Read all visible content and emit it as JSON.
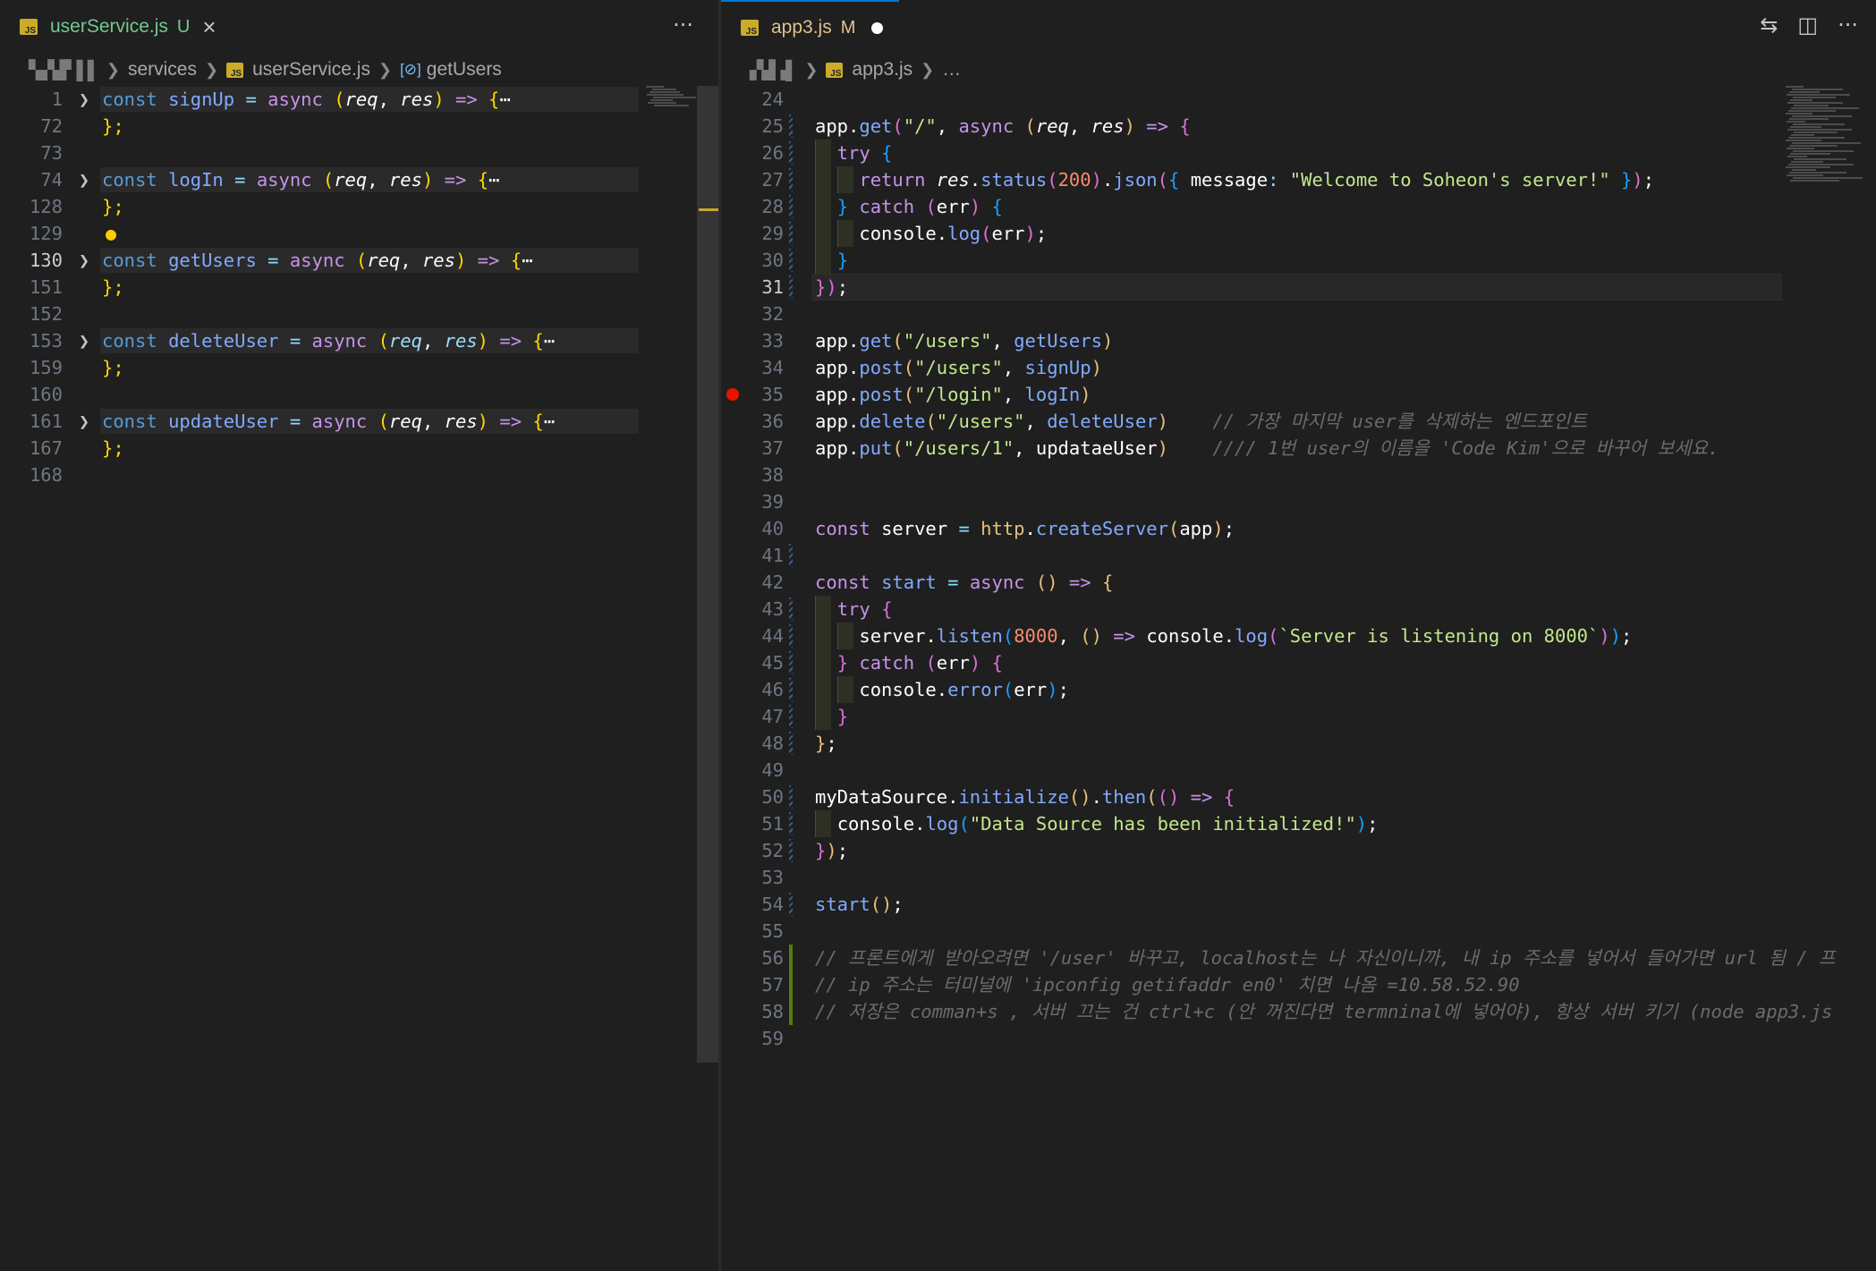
{
  "left": {
    "tab": {
      "filename": "userService.js",
      "badge": "U",
      "close": "×"
    },
    "more": "···",
    "breadcrumb": {
      "obscured": "▚▞▟▘▌▌",
      "folder": "services",
      "file": "userService.js",
      "symbol": "getUsers"
    },
    "lines": [
      {
        "num": "1",
        "folded": true,
        "tokens": [
          [
            "const ",
            "ks"
          ],
          [
            "signUp",
            "bl"
          ],
          [
            " = ",
            "cy"
          ],
          [
            "async ",
            "pu"
          ],
          [
            "(",
            "fy"
          ],
          [
            "req",
            "wi"
          ],
          [
            ", ",
            "w"
          ],
          [
            "res",
            "wi"
          ],
          [
            ")",
            "fy"
          ],
          [
            " => ",
            "pu"
          ],
          [
            "{",
            "fy"
          ],
          [
            "⋯",
            "w"
          ]
        ]
      },
      {
        "num": "72",
        "tokens": [
          [
            "};",
            "fy"
          ]
        ]
      },
      {
        "num": "73",
        "tokens": []
      },
      {
        "num": "74",
        "folded": true,
        "tokens": [
          [
            "const ",
            "ks"
          ],
          [
            "logIn",
            "bl"
          ],
          [
            " = ",
            "cy"
          ],
          [
            "async ",
            "pu"
          ],
          [
            "(",
            "fy"
          ],
          [
            "req",
            "wi"
          ],
          [
            ", ",
            "w"
          ],
          [
            "res",
            "wi"
          ],
          [
            ")",
            "fy"
          ],
          [
            " => ",
            "pu"
          ],
          [
            "{",
            "fy"
          ],
          [
            "⋯",
            "w"
          ]
        ]
      },
      {
        "num": "128",
        "tokens": [
          [
            "};",
            "fy"
          ]
        ]
      },
      {
        "num": "129",
        "lightbulb": true,
        "tokens": []
      },
      {
        "num": "130",
        "current": true,
        "folded": true,
        "tokens": [
          [
            "const ",
            "ks"
          ],
          [
            "getUsers",
            "bl"
          ],
          [
            " = ",
            "cy"
          ],
          [
            "async ",
            "pu"
          ],
          [
            "(",
            "fy"
          ],
          [
            "req",
            "wi"
          ],
          [
            ", ",
            "w"
          ],
          [
            "res",
            "wi"
          ],
          [
            ")",
            "fy"
          ],
          [
            " => ",
            "pu"
          ],
          [
            "{",
            "fy"
          ],
          [
            "⋯",
            "w"
          ]
        ]
      },
      {
        "num": "151",
        "tokens": [
          [
            "};",
            "fy"
          ]
        ]
      },
      {
        "num": "152",
        "tokens": []
      },
      {
        "num": "153",
        "folded": true,
        "tokens": [
          [
            "const ",
            "ks"
          ],
          [
            "deleteUser",
            "bl"
          ],
          [
            " = ",
            "cy"
          ],
          [
            "async ",
            "pu"
          ],
          [
            "(",
            "fy"
          ],
          [
            "req",
            "p"
          ],
          [
            ", ",
            "w"
          ],
          [
            "res",
            "p"
          ],
          [
            ")",
            "fy"
          ],
          [
            " => ",
            "pu"
          ],
          [
            "{",
            "fy"
          ],
          [
            "⋯",
            "w"
          ]
        ]
      },
      {
        "num": "159",
        "tokens": [
          [
            "};",
            "fy"
          ]
        ]
      },
      {
        "num": "160",
        "tokens": []
      },
      {
        "num": "161",
        "folded": true,
        "tokens": [
          [
            "const ",
            "ks"
          ],
          [
            "updateUser",
            "bl"
          ],
          [
            " = ",
            "cy"
          ],
          [
            "async ",
            "pu"
          ],
          [
            "(",
            "fy"
          ],
          [
            "req",
            "wi"
          ],
          [
            ", ",
            "w"
          ],
          [
            "res",
            "wi"
          ],
          [
            ")",
            "fy"
          ],
          [
            " => ",
            "pu"
          ],
          [
            "{",
            "fy"
          ],
          [
            "⋯",
            "w"
          ]
        ]
      },
      {
        "num": "167",
        "tokens": [
          [
            "};",
            "fy"
          ]
        ]
      },
      {
        "num": "168",
        "tokens": []
      }
    ]
  },
  "right": {
    "tab": {
      "filename": "app3.js",
      "badge": "M"
    },
    "actions": {
      "compare": "⇆",
      "split": "◫",
      "more": "···"
    },
    "breadcrumb": {
      "obscured": "▞▟▗▌",
      "file": "app3.js",
      "more": "…"
    },
    "lines": [
      {
        "num": "24",
        "tokens": []
      },
      {
        "num": "25",
        "tokens": [
          [
            "app",
            "w"
          ],
          [
            ".",
            "w"
          ],
          [
            "get",
            "bl"
          ],
          [
            "(",
            "pk"
          ],
          [
            "\"/\"",
            "gn"
          ],
          [
            ", ",
            "w"
          ],
          [
            "async ",
            "pu"
          ],
          [
            "(",
            "y"
          ],
          [
            "req",
            "wi"
          ],
          [
            ", ",
            "w"
          ],
          [
            "res",
            "wi"
          ],
          [
            ")",
            "y"
          ],
          [
            " => ",
            "pu"
          ],
          [
            "{",
            "pk"
          ]
        ]
      },
      {
        "num": "26",
        "tokens": [
          [
            "  ",
            "w"
          ],
          [
            "try ",
            "pu"
          ],
          [
            "{",
            "pb"
          ]
        ]
      },
      {
        "num": "27",
        "tokens": [
          [
            "    ",
            "w"
          ],
          [
            "return ",
            "pu"
          ],
          [
            "res",
            "wi"
          ],
          [
            ".",
            "w"
          ],
          [
            "status",
            "bl"
          ],
          [
            "(",
            "pk"
          ],
          [
            "200",
            "or"
          ],
          [
            ")",
            "pk"
          ],
          [
            ".",
            "w"
          ],
          [
            "json",
            "bl"
          ],
          [
            "(",
            "pk"
          ],
          [
            "{ ",
            "pb"
          ],
          [
            "message",
            "w"
          ],
          [
            ": ",
            "cy"
          ],
          [
            "\"Welcome to Soheon's server!\"",
            "gn"
          ],
          [
            " }",
            "pb"
          ],
          [
            ")",
            "pk"
          ],
          [
            ";",
            "w"
          ]
        ]
      },
      {
        "num": "28",
        "tokens": [
          [
            "  ",
            "w"
          ],
          [
            "} ",
            "pb"
          ],
          [
            "catch ",
            "pu"
          ],
          [
            "(",
            "pk"
          ],
          [
            "err",
            "w"
          ],
          [
            ") ",
            "pk"
          ],
          [
            "{",
            "pb"
          ]
        ]
      },
      {
        "num": "29",
        "tokens": [
          [
            "    ",
            "w"
          ],
          [
            "console",
            "w"
          ],
          [
            ".",
            "w"
          ],
          [
            "log",
            "bl"
          ],
          [
            "(",
            "pk"
          ],
          [
            "err",
            "w"
          ],
          [
            ")",
            "pk"
          ],
          [
            ";",
            "w"
          ]
        ]
      },
      {
        "num": "30",
        "tokens": [
          [
            "  ",
            "w"
          ],
          [
            "}",
            "pb"
          ]
        ]
      },
      {
        "num": "31",
        "current": true,
        "tokens": [
          [
            "}",
            "pk"
          ],
          [
            ")",
            "pk"
          ],
          [
            ";",
            "w"
          ]
        ]
      },
      {
        "num": "32",
        "tokens": []
      },
      {
        "num": "33",
        "tokens": [
          [
            "app",
            "w"
          ],
          [
            ".",
            "w"
          ],
          [
            "get",
            "bl"
          ],
          [
            "(",
            "y"
          ],
          [
            "\"/users\"",
            "gn"
          ],
          [
            ", ",
            "w"
          ],
          [
            "getUsers",
            "bl"
          ],
          [
            ")",
            "y"
          ]
        ]
      },
      {
        "num": "34",
        "tokens": [
          [
            "app",
            "w"
          ],
          [
            ".",
            "w"
          ],
          [
            "post",
            "bl"
          ],
          [
            "(",
            "y"
          ],
          [
            "\"/users\"",
            "gn"
          ],
          [
            ", ",
            "w"
          ],
          [
            "signUp",
            "bl"
          ],
          [
            ")",
            "y"
          ]
        ]
      },
      {
        "num": "35",
        "breakpoint": true,
        "tokens": [
          [
            "app",
            "w"
          ],
          [
            ".",
            "w"
          ],
          [
            "post",
            "bl"
          ],
          [
            "(",
            "y"
          ],
          [
            "\"/login\"",
            "gn"
          ],
          [
            ", ",
            "w"
          ],
          [
            "logIn",
            "bl"
          ],
          [
            ")",
            "y"
          ]
        ]
      },
      {
        "num": "36",
        "tokens": [
          [
            "app",
            "w"
          ],
          [
            ".",
            "w"
          ],
          [
            "delete",
            "bl"
          ],
          [
            "(",
            "y"
          ],
          [
            "\"/users\"",
            "gn"
          ],
          [
            ", ",
            "w"
          ],
          [
            "deleteUser",
            "bl"
          ],
          [
            ")",
            "y"
          ],
          [
            "    // 가장 마지막 user를 삭제하는 엔드포인트",
            "gc"
          ]
        ]
      },
      {
        "num": "37",
        "tokens": [
          [
            "app",
            "w"
          ],
          [
            ".",
            "w"
          ],
          [
            "put",
            "bl"
          ],
          [
            "(",
            "y"
          ],
          [
            "\"/users/1\"",
            "gn"
          ],
          [
            ", ",
            "w"
          ],
          [
            "updataeUser",
            "w"
          ],
          [
            ")",
            "y"
          ],
          [
            "    //// 1번 user의 이름을 'Code Kim'으로 바꾸어 보세요.",
            "gc"
          ]
        ]
      },
      {
        "num": "38",
        "tokens": []
      },
      {
        "num": "39",
        "tokens": []
      },
      {
        "num": "40",
        "tokens": [
          [
            "const ",
            "pu"
          ],
          [
            "server",
            "w"
          ],
          [
            " = ",
            "cy"
          ],
          [
            "http",
            "y"
          ],
          [
            ".",
            "w"
          ],
          [
            "createServer",
            "bl"
          ],
          [
            "(",
            "y"
          ],
          [
            "app",
            "w"
          ],
          [
            ")",
            "y"
          ],
          [
            ";",
            "w"
          ]
        ]
      },
      {
        "num": "41",
        "tokens": []
      },
      {
        "num": "42",
        "tokens": [
          [
            "const ",
            "pu"
          ],
          [
            "start",
            "bl"
          ],
          [
            " = ",
            "cy"
          ],
          [
            "async ",
            "pu"
          ],
          [
            "() ",
            "y"
          ],
          [
            "=> ",
            "pu"
          ],
          [
            "{",
            "y"
          ]
        ]
      },
      {
        "num": "43",
        "tokens": [
          [
            "  ",
            "w"
          ],
          [
            "try ",
            "pu"
          ],
          [
            "{",
            "pk"
          ]
        ]
      },
      {
        "num": "44",
        "tokens": [
          [
            "    ",
            "w"
          ],
          [
            "server",
            "w"
          ],
          [
            ".",
            "w"
          ],
          [
            "listen",
            "bl"
          ],
          [
            "(",
            "pb"
          ],
          [
            "8000",
            "or"
          ],
          [
            ", ",
            "w"
          ],
          [
            "() ",
            "y"
          ],
          [
            "=> ",
            "pu"
          ],
          [
            "console",
            "w"
          ],
          [
            ".",
            "w"
          ],
          [
            "log",
            "bl"
          ],
          [
            "(",
            "pk"
          ],
          [
            "`Server is listening on 8000`",
            "gn"
          ],
          [
            ")",
            "pk"
          ],
          [
            ")",
            "pb"
          ],
          [
            ";",
            "w"
          ]
        ]
      },
      {
        "num": "45",
        "tokens": [
          [
            "  ",
            "w"
          ],
          [
            "} ",
            "pk"
          ],
          [
            "catch ",
            "pu"
          ],
          [
            "(",
            "pk"
          ],
          [
            "err",
            "w"
          ],
          [
            ") ",
            "pk"
          ],
          [
            "{",
            "pk"
          ]
        ]
      },
      {
        "num": "46",
        "tokens": [
          [
            "    ",
            "w"
          ],
          [
            "console",
            "w"
          ],
          [
            ".",
            "w"
          ],
          [
            "error",
            "bl"
          ],
          [
            "(",
            "pb"
          ],
          [
            "err",
            "w"
          ],
          [
            ")",
            "pb"
          ],
          [
            ";",
            "w"
          ]
        ]
      },
      {
        "num": "47",
        "tokens": [
          [
            "  ",
            "w"
          ],
          [
            "}",
            "pk"
          ]
        ]
      },
      {
        "num": "48",
        "tokens": [
          [
            "}",
            "y"
          ],
          [
            ";",
            "w"
          ]
        ]
      },
      {
        "num": "49",
        "tokens": []
      },
      {
        "num": "50",
        "tokens": [
          [
            "myDataSource",
            "w"
          ],
          [
            ".",
            "w"
          ],
          [
            "initialize",
            "bl"
          ],
          [
            "()",
            "y"
          ],
          [
            ".",
            "w"
          ],
          [
            "then",
            "bl"
          ],
          [
            "(",
            "y"
          ],
          [
            "() ",
            "pk"
          ],
          [
            "=> ",
            "pu"
          ],
          [
            "{",
            "pk"
          ]
        ]
      },
      {
        "num": "51",
        "tokens": [
          [
            "  ",
            "w"
          ],
          [
            "console",
            "w"
          ],
          [
            ".",
            "w"
          ],
          [
            "log",
            "bl"
          ],
          [
            "(",
            "pb"
          ],
          [
            "\"Data Source has been initialized!\"",
            "gn"
          ],
          [
            ")",
            "pb"
          ],
          [
            ";",
            "w"
          ]
        ]
      },
      {
        "num": "52",
        "tokens": [
          [
            "}",
            "pk"
          ],
          [
            ")",
            "y"
          ],
          [
            ";",
            "w"
          ]
        ]
      },
      {
        "num": "53",
        "tokens": []
      },
      {
        "num": "54",
        "tokens": [
          [
            "start",
            "bl"
          ],
          [
            "()",
            "y"
          ],
          [
            ";",
            "w"
          ]
        ]
      },
      {
        "num": "55",
        "tokens": []
      },
      {
        "num": "56",
        "added": true,
        "tokens": [
          [
            "// 프론트에게 받아오려면 '/user' 바꾸고, localhost는 나 자신이니까, 내 ip 주소를 넣어서 들어가면 url 됨 / 프",
            "gc"
          ]
        ]
      },
      {
        "num": "57",
        "added": true,
        "tokens": [
          [
            "// ip 주소는 터미널에 'ipconfig getifaddr en0' 치면 나옴 =10.58.52.90",
            "gc"
          ]
        ]
      },
      {
        "num": "58",
        "added": true,
        "tokens": [
          [
            "// 저장은 comman+s , 서버 끄는 건 ctrl+c (안 꺼진다면 termninal에 넣어야), 항상 서버 키기 (node app3.js",
            "gc"
          ]
        ]
      },
      {
        "num": "59",
        "tokens": []
      }
    ]
  }
}
